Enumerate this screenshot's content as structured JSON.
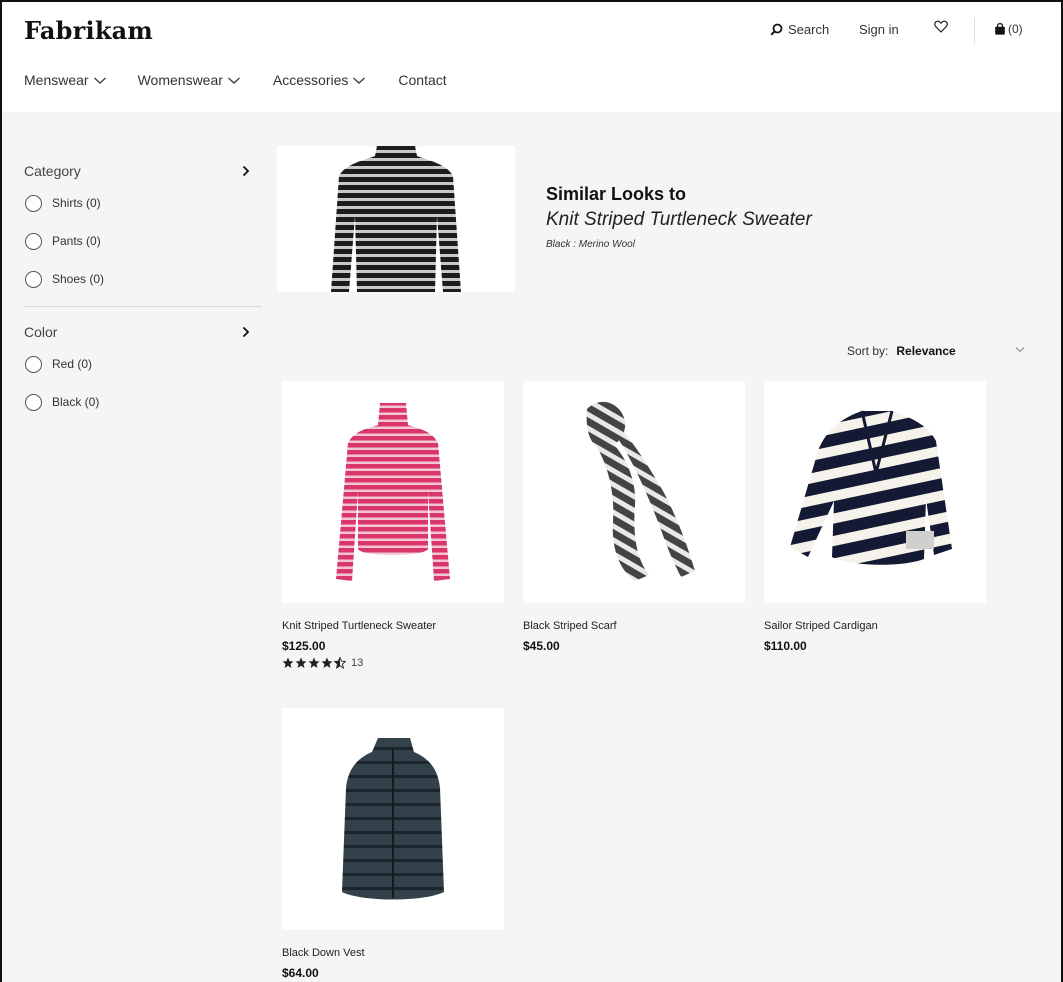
{
  "brand": {
    "logo_text": "Fabrikam"
  },
  "header": {
    "search_label": "Search",
    "signin_label": "Sign in",
    "cart_count": "(0)"
  },
  "nav": {
    "items": [
      {
        "label": "Menswear",
        "has_dropdown": true
      },
      {
        "label": "Womenswear",
        "has_dropdown": true
      },
      {
        "label": "Accessories",
        "has_dropdown": true
      },
      {
        "label": "Contact",
        "has_dropdown": false
      }
    ]
  },
  "sidebar": {
    "facets": [
      {
        "title": "Category",
        "options": [
          "Shirts (0)",
          "Pants (0)",
          "Shoes (0)"
        ]
      },
      {
        "title": "Color",
        "options": [
          "Red (0)",
          "Black (0)"
        ]
      }
    ]
  },
  "hero": {
    "title": "Similar Looks to",
    "product_name": "Knit Striped Turtleneck Sweater",
    "meta": "Black : Merino Wool"
  },
  "sort": {
    "label": "Sort by:",
    "value": "Relevance"
  },
  "products": [
    {
      "name": "Knit Striped Turtleneck Sweater",
      "price": "$125.00",
      "rating": 4.5,
      "review_count": "13",
      "image": "pink-striped-sweater"
    },
    {
      "name": "Black Striped Scarf",
      "price": "$45.00",
      "image": "striped-scarf"
    },
    {
      "name": "Sailor Striped Cardigan",
      "price": "$110.00",
      "image": "striped-cardigan"
    },
    {
      "name": "Black Down Vest",
      "price": "$64.00",
      "image": "down-vest"
    }
  ],
  "colors": {
    "page_bg": "#f6f5f3",
    "sweater_pink": "#d9366a",
    "stripe_dark": "#1a1a1a",
    "cardigan_navy": "#141a33",
    "vest": "#2f3b43"
  }
}
